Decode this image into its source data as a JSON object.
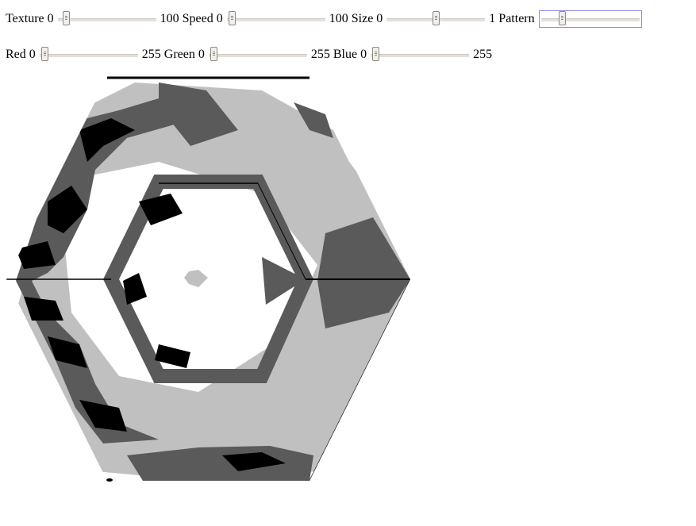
{
  "controls": {
    "texture": {
      "label": "Texture",
      "min": "0",
      "max": "100",
      "value": 5
    },
    "speed": {
      "label": "Speed",
      "min": "0",
      "max": "100",
      "value": 5
    },
    "size": {
      "label": "Size",
      "min": "0",
      "max": "1",
      "value": 0.5
    },
    "pattern": {
      "label": "Pattern",
      "value": 0.2
    },
    "red": {
      "label": "Red",
      "min": "0",
      "max": "255",
      "value": 0
    },
    "green": {
      "label": "Green",
      "min": "0",
      "max": "255",
      "value": 0
    },
    "blue": {
      "label": "Blue",
      "min": "0",
      "max": "255",
      "value": 0
    }
  },
  "canvas": {
    "palette": [
      "#000000",
      "#5a5a5a",
      "#c0c0c0",
      "#ffffff"
    ]
  }
}
